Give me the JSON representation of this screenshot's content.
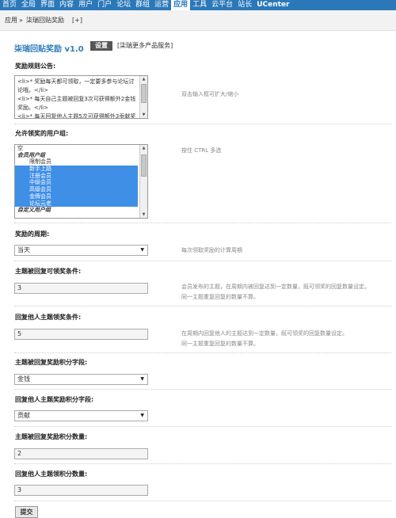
{
  "nav": {
    "items": [
      "首页",
      "全局",
      "界面",
      "内容",
      "用户",
      "门户",
      "论坛",
      "群组",
      "运营",
      "应用",
      "工具",
      "云平台",
      "站长",
      "UCenter"
    ],
    "active_index": 9
  },
  "breadcrumb": {
    "root": "应用",
    "sep": "»",
    "current": "柒瑞回贴奖励",
    "add": "[+]"
  },
  "plugin": {
    "title": "柒瑞回贴奖励  v1.0",
    "settings_label": "设置",
    "more_label": "[柒瑞更多产品服务]"
  },
  "announcement": {
    "label": "奖励规则公告:",
    "content": "<li>* 奖励每天都可领取，一定要多参与论坛讨论哦。</li>\n<li>* 每天自己主题被回复3次可获得额外2金钱奖励。</li>\n<li>* 每天回复他人主题5次可获得额外3贡献奖励。</li>",
    "hint": "双击输入框可扩大/缩小"
  },
  "groups": {
    "label": "允许领奖的用户组:",
    "hint": "按住 CTRL 多选",
    "options": [
      {
        "text": "空",
        "type": "plain",
        "selected": false
      },
      {
        "text": "会员用户组",
        "type": "group",
        "selected": false
      },
      {
        "text": "限制会员",
        "type": "indent",
        "selected": false
      },
      {
        "text": "新手上路",
        "type": "indent",
        "selected": true
      },
      {
        "text": "注册会员",
        "type": "indent",
        "selected": true
      },
      {
        "text": "中级会员",
        "type": "indent",
        "selected": true
      },
      {
        "text": "高级会员",
        "type": "indent",
        "selected": true
      },
      {
        "text": "金牌会员",
        "type": "indent",
        "selected": true
      },
      {
        "text": "论坛元老",
        "type": "indent",
        "selected": true
      },
      {
        "text": "自定义用户组",
        "type": "group",
        "selected": false
      }
    ]
  },
  "period": {
    "label": "奖励的周期:",
    "value": "当天",
    "hint": "每次领取奖励的计算周期"
  },
  "own_reply": {
    "label": "主题被回复可领奖条件:",
    "value": "3",
    "hint_line1": "会员发布的主题，在周期内被回复达到一定数量，既可领奖的回复数量设定。",
    "hint_line2": "同一主题重复回复的数量不算。"
  },
  "reply_others": {
    "label": "回复他人主题领奖条件:",
    "value": "5",
    "hint_line1": "在周期内回复他人的主题达到一定数量，既可领奖的回复数量设定。",
    "hint_line2": "同一主题重复回复的数量不算。"
  },
  "own_field": {
    "label": "主题被回复奖励积分字段:",
    "value": "金钱"
  },
  "others_field": {
    "label": "回复他人主题奖励积分字段:",
    "value": "贡献"
  },
  "own_amount": {
    "label": "主题被回复奖励积分数量:",
    "value": "2"
  },
  "others_amount": {
    "label": "回复他人主题领积分数量:",
    "value": "3"
  },
  "submit_label": "提交"
}
